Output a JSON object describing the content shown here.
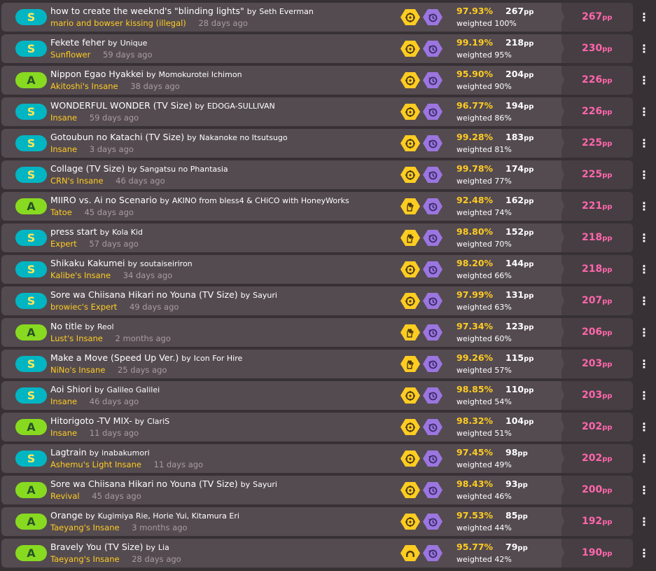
{
  "scores": [
    {
      "grade": "S",
      "title": "how to create the weeknd's \"blinding lights\"",
      "by": "by",
      "artist": "Seth Everman",
      "difficulty": "mario and bowser kissing (illegal)",
      "ago": "28 days ago",
      "mods": [
        "autopilot-icon",
        "nightcore-icon"
      ],
      "accuracy": "97.93%",
      "pp": "267",
      "pp_unit": "pp",
      "weighted": "weighted 100%",
      "weighted_pp": "267",
      "weighted_pp_unit": "pp"
    },
    {
      "grade": "S",
      "title": "Fekete feher",
      "by": "by",
      "artist": "Unique",
      "difficulty": "Sunflower",
      "ago": "59 days ago",
      "mods": [
        "autopilot-icon",
        "nightcore-icon"
      ],
      "accuracy": "99.19%",
      "pp": "218",
      "pp_unit": "pp",
      "weighted": "weighted 95%",
      "weighted_pp": "230",
      "weighted_pp_unit": "pp"
    },
    {
      "grade": "A",
      "title": "Nippon Egao Hyakkei",
      "by": "by",
      "artist": "Momokurotei Ichimon",
      "difficulty": "Akitoshi's Insane",
      "ago": "38 days ago",
      "mods": [
        "autopilot-icon",
        "nightcore-icon"
      ],
      "accuracy": "95.90%",
      "pp": "204",
      "pp_unit": "pp",
      "weighted": "weighted 90%",
      "weighted_pp": "226",
      "weighted_pp_unit": "pp"
    },
    {
      "grade": "S",
      "title": "WONDERFUL WONDER (TV Size)",
      "by": "by",
      "artist": "EDOGA-SULLIVAN",
      "difficulty": "Insane",
      "ago": "59 days ago",
      "mods": [
        "autopilot-icon",
        "nightcore-icon"
      ],
      "accuracy": "96.77%",
      "pp": "194",
      "pp_unit": "pp",
      "weighted": "weighted 86%",
      "weighted_pp": "226",
      "weighted_pp_unit": "pp"
    },
    {
      "grade": "S",
      "title": "Gotoubun no Katachi (TV Size)",
      "by": "by",
      "artist": "Nakanoke no Itsutsugo",
      "difficulty": "Insane",
      "ago": "3 days ago",
      "mods": [
        "autopilot-icon",
        "nightcore-icon"
      ],
      "accuracy": "99.28%",
      "pp": "183",
      "pp_unit": "pp",
      "weighted": "weighted 81%",
      "weighted_pp": "225",
      "weighted_pp_unit": "pp"
    },
    {
      "grade": "S",
      "title": "Collage (TV Size)",
      "by": "by",
      "artist": "Sangatsu no Phantasia",
      "difficulty": "CRN's Insane",
      "ago": "46 days ago",
      "mods": [
        "autopilot-icon",
        "nightcore-icon"
      ],
      "accuracy": "99.78%",
      "pp": "174",
      "pp_unit": "pp",
      "weighted": "weighted 77%",
      "weighted_pp": "225",
      "weighted_pp_unit": "pp"
    },
    {
      "grade": "A",
      "title": "MIIRO vs. Ai no Scenario",
      "by": "by",
      "artist": "AKINO from bless4 & CHiCO with HoneyWorks",
      "difficulty": "Tatoe",
      "ago": "45 days ago",
      "mods": [
        "relax-icon",
        "nightcore-icon"
      ],
      "accuracy": "92.48%",
      "pp": "162",
      "pp_unit": "pp",
      "weighted": "weighted 74%",
      "weighted_pp": "221",
      "weighted_pp_unit": "pp"
    },
    {
      "grade": "S",
      "title": "press start",
      "by": "by",
      "artist": "Kola Kid",
      "difficulty": "Expert",
      "ago": "57 days ago",
      "mods": [
        "relax-icon",
        "nightcore-icon"
      ],
      "accuracy": "98.80%",
      "pp": "152",
      "pp_unit": "pp",
      "weighted": "weighted 70%",
      "weighted_pp": "218",
      "weighted_pp_unit": "pp"
    },
    {
      "grade": "S",
      "title": "Shikaku Kakumei",
      "by": "by",
      "artist": "soutaiseiriron",
      "difficulty": "Kalibe's Insane",
      "ago": "34 days ago",
      "mods": [
        "autopilot-icon",
        "nightcore-icon"
      ],
      "accuracy": "98.20%",
      "pp": "144",
      "pp_unit": "pp",
      "weighted": "weighted 66%",
      "weighted_pp": "218",
      "weighted_pp_unit": "pp"
    },
    {
      "grade": "S",
      "title": "Sore wa Chiisana Hikari no Youna (TV Size)",
      "by": "by",
      "artist": "Sayuri",
      "difficulty": "browiec's Expert",
      "ago": "49 days ago",
      "mods": [
        "autopilot-icon",
        "nightcore-icon"
      ],
      "accuracy": "97.99%",
      "pp": "131",
      "pp_unit": "pp",
      "weighted": "weighted 63%",
      "weighted_pp": "207",
      "weighted_pp_unit": "pp"
    },
    {
      "grade": "A",
      "title": "No title",
      "by": "by",
      "artist": "Reol",
      "difficulty": "Lust's Insane",
      "ago": "2 months ago",
      "mods": [
        "relax-icon",
        "nightcore-icon"
      ],
      "accuracy": "97.34%",
      "pp": "123",
      "pp_unit": "pp",
      "weighted": "weighted 60%",
      "weighted_pp": "206",
      "weighted_pp_unit": "pp"
    },
    {
      "grade": "S",
      "title": "Make a Move (Speed Up Ver.)",
      "by": "by",
      "artist": "Icon For Hire",
      "difficulty": "NiNo's Insane",
      "ago": "25 days ago",
      "mods": [
        "relax-icon",
        "nightcore-icon"
      ],
      "accuracy": "99.26%",
      "pp": "115",
      "pp_unit": "pp",
      "weighted": "weighted 57%",
      "weighted_pp": "203",
      "weighted_pp_unit": "pp"
    },
    {
      "grade": "S",
      "title": "Aoi Shiori",
      "by": "by",
      "artist": "Galileo Galilei",
      "difficulty": "Insane",
      "ago": "46 days ago",
      "mods": [
        "autopilot-icon",
        "nightcore-icon"
      ],
      "accuracy": "98.85%",
      "pp": "110",
      "pp_unit": "pp",
      "weighted": "weighted 54%",
      "weighted_pp": "203",
      "weighted_pp_unit": "pp"
    },
    {
      "grade": "A",
      "title": "Hitorigoto -TV MIX-",
      "by": "by",
      "artist": "ClariS",
      "difficulty": "Insane",
      "ago": "11 days ago",
      "mods": [
        "autopilot-icon",
        "nightcore-icon"
      ],
      "accuracy": "98.32%",
      "pp": "104",
      "pp_unit": "pp",
      "weighted": "weighted 51%",
      "weighted_pp": "202",
      "weighted_pp_unit": "pp"
    },
    {
      "grade": "S",
      "title": "Lagtrain",
      "by": "by",
      "artist": "inabakumori",
      "difficulty": "Ashemu's Light Insane",
      "ago": "11 days ago",
      "mods": [
        "autopilot-icon",
        "nightcore-icon"
      ],
      "accuracy": "97.45%",
      "pp": "98",
      "pp_unit": "pp",
      "weighted": "weighted 49%",
      "weighted_pp": "202",
      "weighted_pp_unit": "pp"
    },
    {
      "grade": "A",
      "title": "Sore wa Chiisana Hikari no Youna (TV Size)",
      "by": "by",
      "artist": "Sayuri",
      "difficulty": "Revival",
      "ago": "45 days ago",
      "mods": [
        "autopilot-icon",
        "nightcore-icon"
      ],
      "accuracy": "98.43%",
      "pp": "93",
      "pp_unit": "pp",
      "weighted": "weighted 46%",
      "weighted_pp": "200",
      "weighted_pp_unit": "pp"
    },
    {
      "grade": "A",
      "title": "Orange",
      "by": "by",
      "artist": "Kugimiya Rie, Horie Yui, Kitamura Eri",
      "difficulty": "Taeyang's Insane",
      "ago": "3 months ago",
      "mods": [
        "autopilot-icon",
        "nightcore-icon"
      ],
      "accuracy": "97.53%",
      "pp": "85",
      "pp_unit": "pp",
      "weighted": "weighted 44%",
      "weighted_pp": "192",
      "weighted_pp_unit": "pp"
    },
    {
      "grade": "A",
      "title": "Bravely You (TV Size)",
      "by": "by",
      "artist": "Lia",
      "difficulty": "Taeyang's Insane",
      "ago": "28 days ago",
      "mods": [
        "hidden-icon",
        "nightcore-icon"
      ],
      "accuracy": "95.77%",
      "pp": "79",
      "pp_unit": "pp",
      "weighted": "weighted 42%",
      "weighted_pp": "190",
      "weighted_pp_unit": "pp"
    }
  ],
  "menu_glyph": "⋮",
  "colors": {
    "background": "#373135",
    "row": "#544b50",
    "pp_panel": "#463e43",
    "grade_s": "#02b5c3",
    "grade_s_text": "#ffe657",
    "grade_a": "#88da20",
    "grade_a_text": "#275227",
    "difficulty": "#ffcc22",
    "accuracy": "#ffcc22",
    "mod_yellow": "#ffcc22",
    "mod_purple": "#9b76e0",
    "weighted_pp": "#ff66ab",
    "muted": "#a89ca3"
  }
}
